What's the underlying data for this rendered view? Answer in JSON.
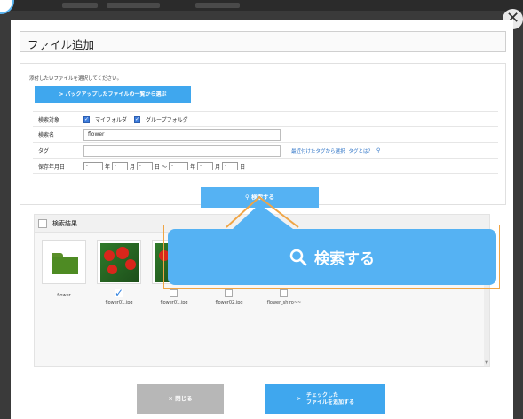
{
  "dialog": {
    "title": "ファイル追加",
    "close_glyph": "✕"
  },
  "upload": {
    "instruction": "添付したいファイルを選択してください。",
    "backup_button": "> バックアップしたファイルの一覧から選ぶ"
  },
  "form": {
    "target_label": "検索対象",
    "target_options": [
      {
        "label": "マイフォルダ",
        "checked": true
      },
      {
        "label": "グループフォルダ",
        "checked": true
      }
    ],
    "name_label": "検索名",
    "name_value": "flower",
    "tag_label": "タグ",
    "tag_value": "",
    "recent_tags_link": "最近付けたタグから選択",
    "what_is_tag_link": "タグとは？",
    "date_label": "保存年月日",
    "date_select_value": "-",
    "year_unit": "年",
    "month_unit": "月",
    "day_unit": "日",
    "range_separator": "〜"
  },
  "search": {
    "button_label": "検索する"
  },
  "results": {
    "header_label": "検索結果",
    "items": [
      {
        "caption": "flower",
        "type": "folder"
      },
      {
        "caption": "flower01.jpg",
        "type": "photo",
        "checked": true
      },
      {
        "caption": "flower01.jpg",
        "type": "photo",
        "checked": false
      },
      {
        "caption": "flower02.jpg",
        "type": "photo",
        "checked": false
      },
      {
        "caption": "flower_shiro~~",
        "type": "photo",
        "checked": false
      }
    ]
  },
  "callout": {
    "label": "検索する",
    "accent_color": "#55b2f3",
    "border_color": "#f0a545"
  },
  "footer": {
    "close_button": "× 閉じる",
    "add_button_line1": "チェックした",
    "add_button_line2": "ファイルを追加する",
    "add_arrow": ">"
  },
  "colors": {
    "primary": "#3fa7ee",
    "folder_green": "#4e8b23",
    "link": "#2b72c6"
  }
}
